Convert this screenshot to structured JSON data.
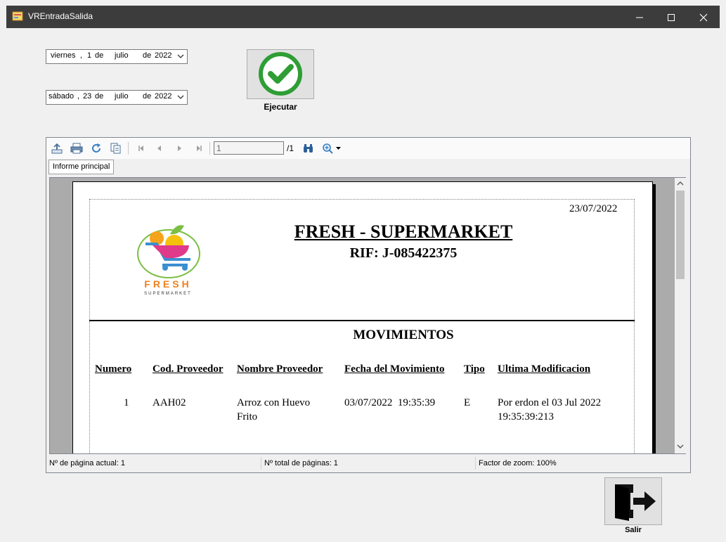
{
  "window": {
    "title": "VREntradaSalida",
    "minimize_icon": "minimize-icon",
    "maximize_icon": "maximize-icon",
    "close_icon": "close-icon"
  },
  "date_from": {
    "weekday": "viernes",
    "day": "1",
    "month": "julio",
    "year": "2022"
  },
  "date_to": {
    "weekday": "sábado",
    "day": "23",
    "month": "julio",
    "year": "2022"
  },
  "execute_button": {
    "label": "Ejecutar",
    "icon": "checkmark-circle-icon"
  },
  "exit_button": {
    "label": "Salir",
    "icon": "exit-door-icon"
  },
  "viewer": {
    "toolbar": {
      "current_page": "1",
      "total_pages": "/1",
      "icons": [
        "export-icon",
        "print-icon",
        "refresh-icon",
        "page-setup-icon",
        "first-page-icon",
        "previous-page-icon",
        "next-page-icon",
        "last-page-icon",
        "find-icon",
        "zoom-icon"
      ]
    },
    "tab_label": "Informe principal",
    "status": {
      "current_page": "Nº de página actual: 1",
      "total_pages": "Nº total de páginas: 1",
      "zoom": "Factor de zoom: 100%"
    }
  },
  "report": {
    "date": "23/07/2022",
    "logo_text": "FRESH",
    "logo_subtext": "SUPERMARKET",
    "company": "FRESH - SUPERMARKET",
    "rif": "RIF: J-085422375",
    "section_title": "MOVIMIENTOS",
    "columns": [
      "Numero",
      "Cod. Proveedor",
      "Nombre Proveedor",
      "Fecha del Movimiento",
      "Tipo",
      "Ultima Modificacion"
    ],
    "rows": [
      {
        "numero": "1",
        "codigo": "AAH02",
        "nombre_1": "Arroz con Huevo",
        "nombre_2": "Frito",
        "fecha": "03/07/2022  19:35:39",
        "tipo": "E",
        "modificacion_1": "Por erdon el 03 Jul 2022",
        "modificacion_2": "19:35:39:213"
      }
    ]
  }
}
